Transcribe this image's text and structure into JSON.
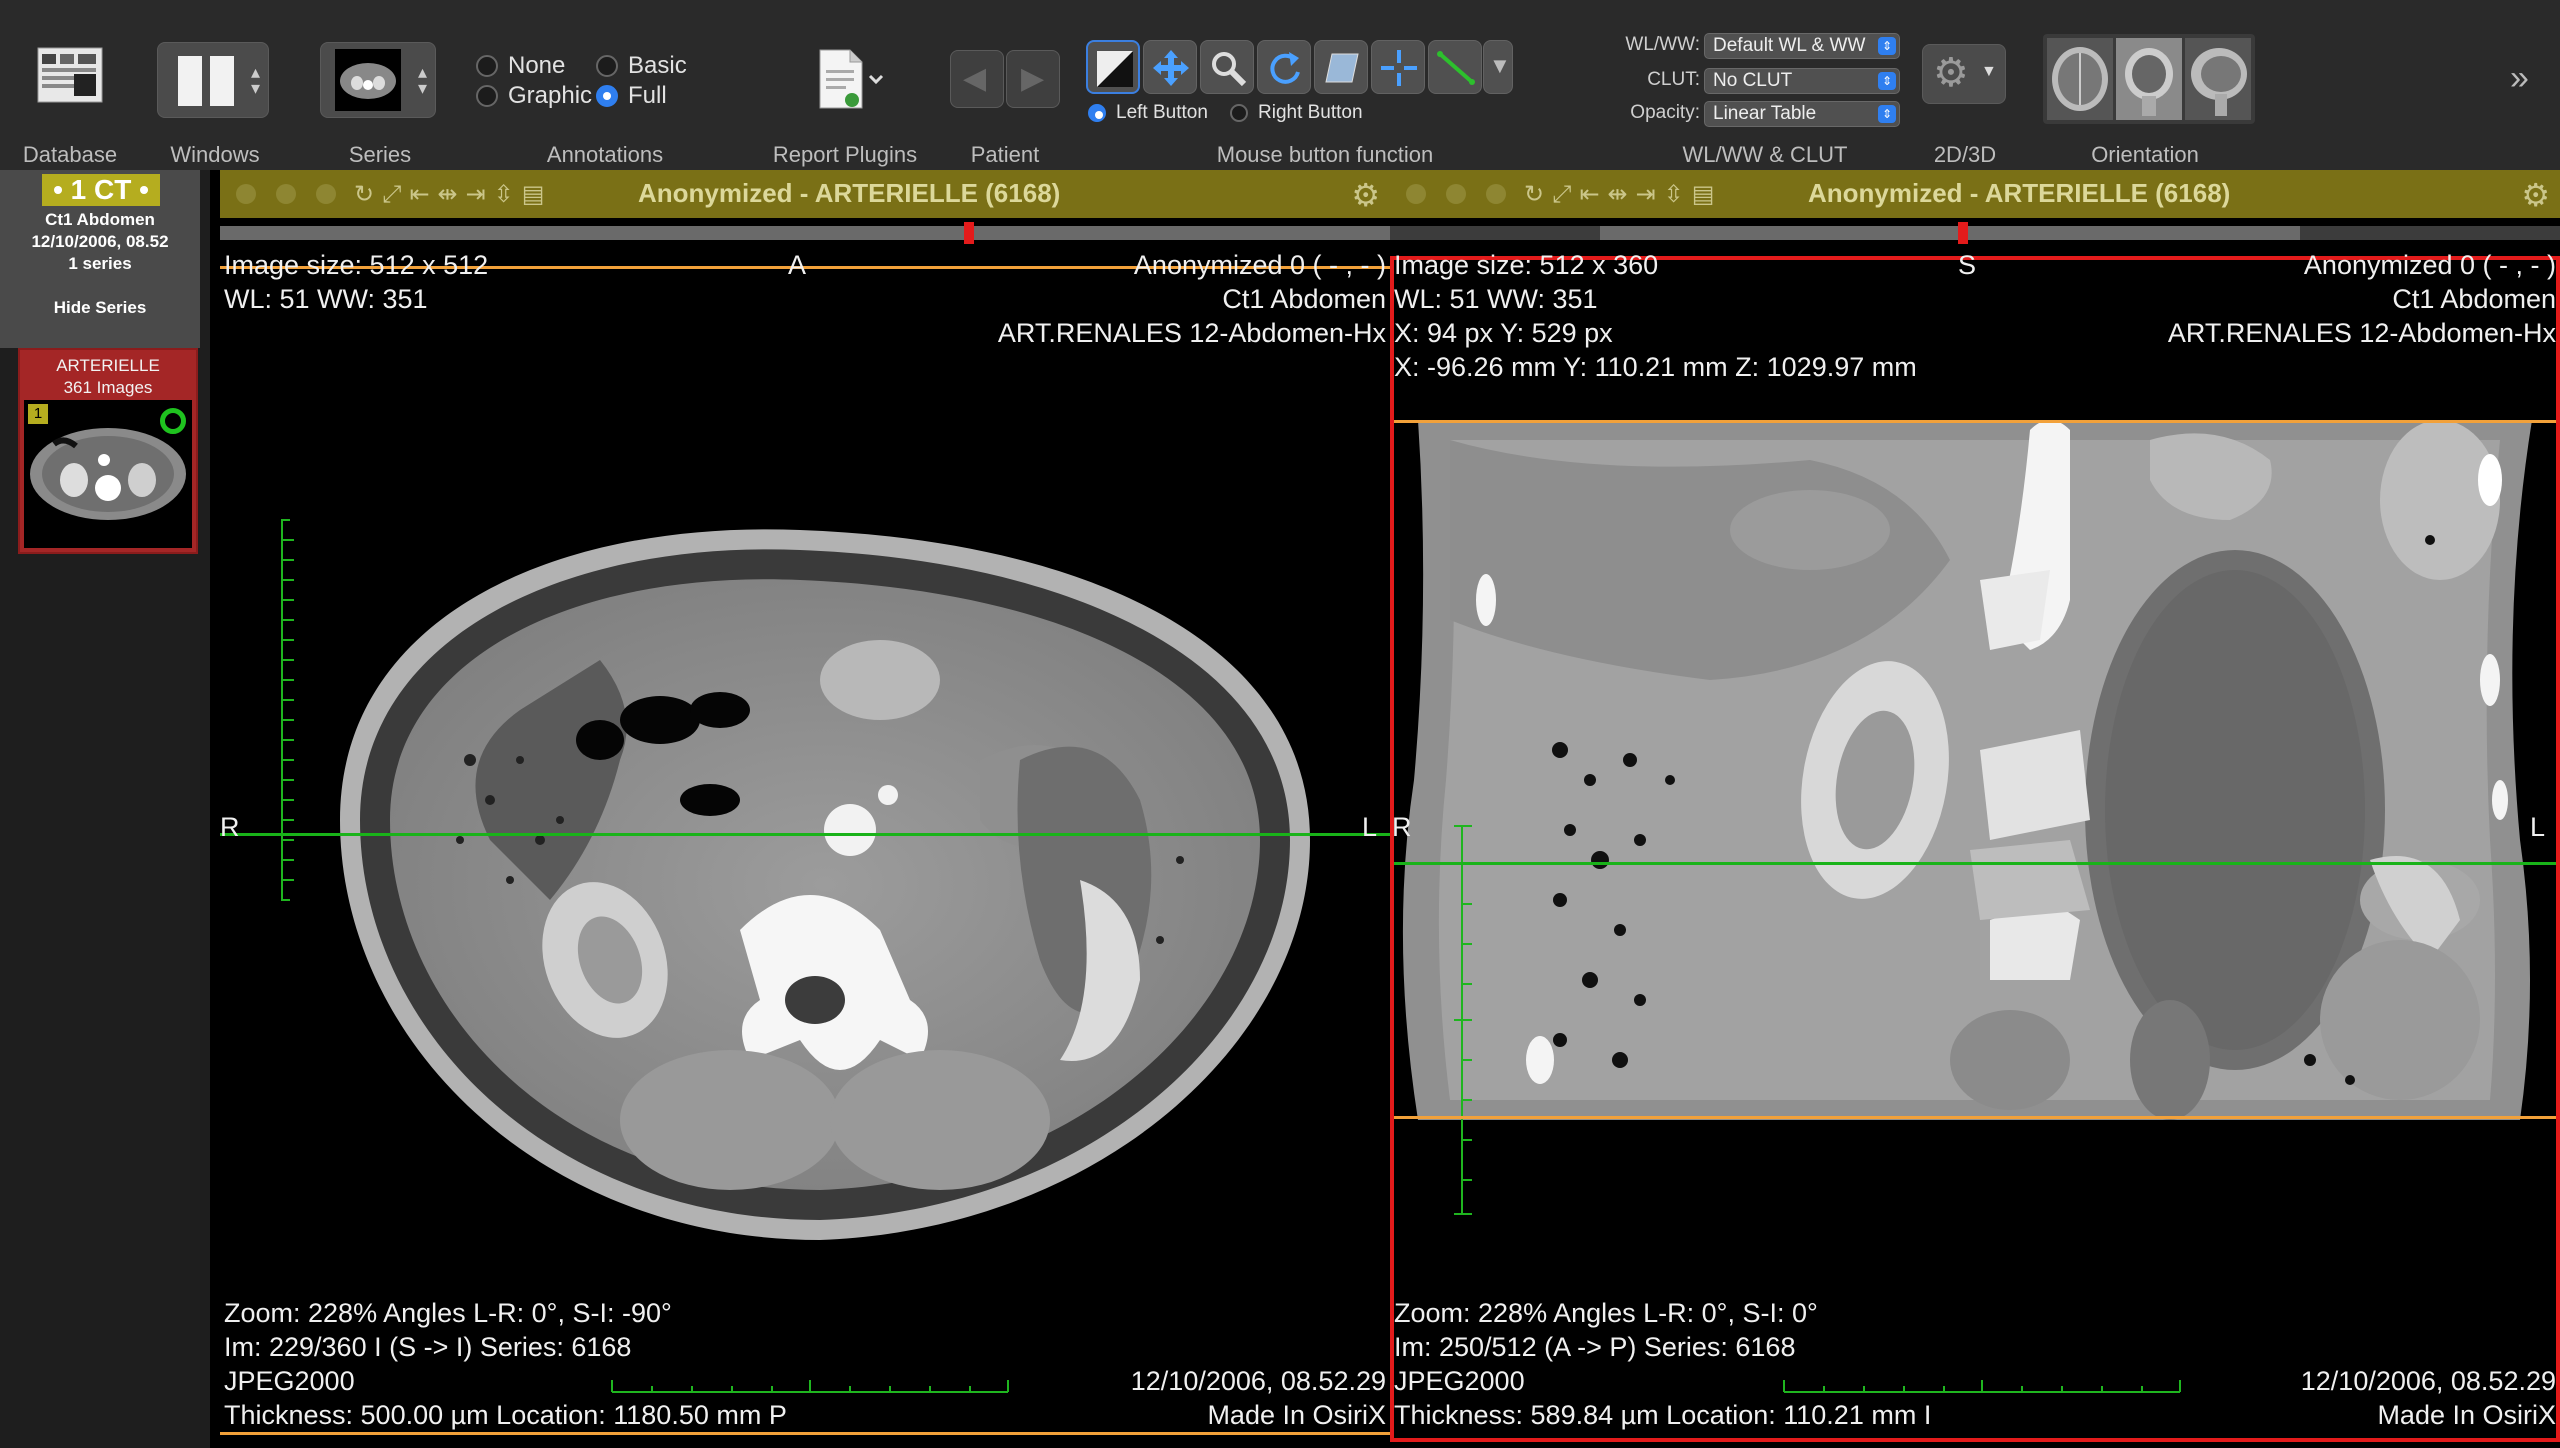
{
  "toolbar": {
    "labels": {
      "database": "Database",
      "windows": "Windows",
      "series": "Series",
      "annotations": "Annotations",
      "report_plugins": "Report Plugins",
      "patient": "Patient",
      "mouse_button_function": "Mouse button function",
      "wlww_clut": "WL/WW & CLUT",
      "two_d_three_d": "2D/3D",
      "orientation": "Orientation"
    },
    "annotations": {
      "none": "None",
      "basic": "Basic",
      "graphic": "Graphic",
      "full": "Full",
      "selected": "Full"
    },
    "mouse_buttons": {
      "left": "Left Button",
      "right": "Right Button",
      "selected": "Left Button"
    },
    "wlww": {
      "wl_label": "WL/WW:",
      "wl_value": "Default WL & WW",
      "clut_label": "CLUT:",
      "clut_value": "No CLUT",
      "opacity_label": "Opacity:",
      "opacity_value": "Linear Table"
    },
    "icons": {
      "expand": "double-chevron-right-icon"
    }
  },
  "study": {
    "modality": "• 1 CT •",
    "description": "Ct1 Abdomen",
    "datetime": "12/10/2006, 08.52",
    "series_count": "1 series",
    "hide_series": "Hide Series"
  },
  "series": {
    "name": "ARTERIELLE",
    "count": "361 Images",
    "number": "1"
  },
  "viewer_left": {
    "title": "Anonymized - ARTERIELLE (6168)",
    "image_size": "Image size: 512 x 512",
    "wl_ww": "WL: 51 WW: 351",
    "orient_top": "A",
    "orient_left": "R",
    "orient_right": "L",
    "patient": "Anonymized 0 ( - , - )",
    "study": "Ct1 Abdomen",
    "protocol": "ART.RENALES 12-Abdomen-Hx",
    "zoom": "Zoom: 228% Angles L-R: 0°, S-I: -90°",
    "im": "Im: 229/360  I (S -> I) Series:  6168",
    "compression": "JPEG2000",
    "thickness": "Thickness: 500.00 µm Location: 1180.50 mm  P",
    "date": "12/10/2006, 08.52.29",
    "made": "Made In OsiriX",
    "scroll_position": 0.64
  },
  "viewer_right": {
    "title": "Anonymized - ARTERIELLE (6168)",
    "image_size": "Image size: 512 x 360",
    "wl_ww": "WL: 51 WW: 351",
    "pixel": "X: 94 px Y: 529 px",
    "mm": "X: -96.26 mm Y: 110.21 mm Z: 1029.97 mm",
    "orient_top": "S",
    "orient_left": "R",
    "orient_right": "L",
    "patient": "Anonymized 0 ( - , - )",
    "study": "Ct1 Abdomen",
    "protocol": "ART.RENALES 12-Abdomen-Hx",
    "zoom": "Zoom: 228% Angles L-R: 0°, S-I: 0°",
    "im": "Im: 250/512  (A -> P) Series:  6168",
    "compression": "JPEG2000",
    "thickness": "Thickness: 589.84 µm Location: 110.21 mm  I",
    "date": "12/10/2006, 08.52.29",
    "made": "Made In OsiriX",
    "scroll_position": 0.49
  },
  "colors": {
    "accent": "#2f7ff0",
    "title_bar": "#7a7016",
    "selection": "#e31b1b",
    "reference_line": "#19b319",
    "slab_line": "#f2a13a",
    "series_bg": "#a42626"
  }
}
